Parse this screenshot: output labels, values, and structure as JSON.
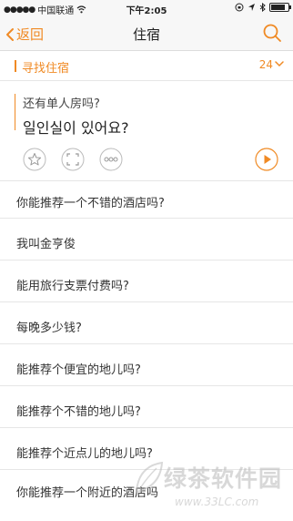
{
  "status_bar": {
    "carrier": "中国联通",
    "time": "下午2:05"
  },
  "nav": {
    "back_label": "返回",
    "title": "住宿"
  },
  "section": {
    "label": "寻找住宿",
    "count": "24"
  },
  "card": {
    "chinese": "还有单人房吗?",
    "korean": "일인실이 있어요?"
  },
  "phrases": [
    "你能推荐一个不错的酒店吗?",
    "我叫金亨俊",
    "能用旅行支票付费吗?",
    "每晚多少钱?",
    "能推荐个便宜的地儿吗?",
    "能推荐个不错的地儿吗?",
    "能推荐个近点儿的地儿吗?",
    "你能推荐一个附近的酒店吗"
  ],
  "watermark": {
    "brand": "绿茶软件园",
    "url": "www.33LC.com"
  },
  "colors": {
    "accent": "#f08a24",
    "text": "#333333",
    "divider": "#e6e6e6"
  }
}
